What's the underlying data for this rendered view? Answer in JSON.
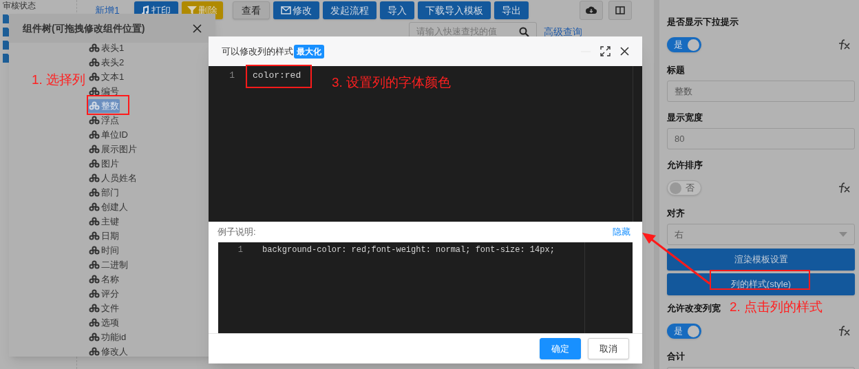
{
  "sidebar": {
    "heading": "审核状态"
  },
  "toolbar": {
    "buttons": [
      {
        "label": "新增1",
        "kind": "link"
      },
      {
        "label": "打印",
        "kind": "primary"
      },
      {
        "label": "删除",
        "kind": "warning"
      },
      {
        "label": "查看",
        "kind": "default"
      },
      {
        "label": "修改",
        "kind": "primary"
      },
      {
        "label": "发起流程",
        "kind": "primary"
      },
      {
        "label": "导入",
        "kind": "primary"
      },
      {
        "label": "下载导入模板",
        "kind": "primary"
      },
      {
        "label": "导出",
        "kind": "primary"
      }
    ]
  },
  "search": {
    "placeholder": "请输入快速查找的值",
    "advanced_link": "高级查询"
  },
  "properties": [
    {
      "kind": "toggle",
      "label": "是否显示下拉提示",
      "on": true,
      "text": "是"
    },
    {
      "kind": "input",
      "label": "标题",
      "value": "整数"
    },
    {
      "kind": "input",
      "label": "显示宽度",
      "value": "80"
    },
    {
      "kind": "toggle",
      "label": "允许排序",
      "on": false,
      "text": "否"
    },
    {
      "kind": "select",
      "label": "对齐",
      "value": "右"
    },
    {
      "kind": "button",
      "text": "渲染模板设置"
    },
    {
      "kind": "button",
      "text": "列的样式(style)"
    },
    {
      "kind": "toggle",
      "label": "允许改变列宽",
      "on": true,
      "text": "是"
    },
    {
      "kind": "input",
      "label": "合计"
    }
  ],
  "tree_dialog": {
    "title": "组件树(可拖拽修改组件位置)",
    "items": [
      {
        "label": "表头1",
        "selected": false
      },
      {
        "label": "表头2",
        "selected": false
      },
      {
        "label": "文本1",
        "selected": false
      },
      {
        "label": "编号",
        "selected": false
      },
      {
        "label": "整数",
        "selected": true
      },
      {
        "label": "浮点",
        "selected": false
      },
      {
        "label": "单位ID",
        "selected": false
      },
      {
        "label": "展示图片",
        "selected": false
      },
      {
        "label": "图片",
        "selected": false
      },
      {
        "label": "人员姓名",
        "selected": false
      },
      {
        "label": "部门",
        "selected": false
      },
      {
        "label": "创建人",
        "selected": false
      },
      {
        "label": "主键",
        "selected": false
      },
      {
        "label": "日期",
        "selected": false
      },
      {
        "label": "时间",
        "selected": false
      },
      {
        "label": "二进制",
        "selected": false
      },
      {
        "label": "名称",
        "selected": false
      },
      {
        "label": "评分",
        "selected": false
      },
      {
        "label": "文件",
        "selected": false
      },
      {
        "label": "选项",
        "selected": false
      },
      {
        "label": "功能id",
        "selected": false
      },
      {
        "label": "修改人",
        "selected": false
      }
    ]
  },
  "style_dialog": {
    "title": "可以修改列的样式",
    "badge": "最大化",
    "code": [
      {
        "line": "1",
        "text": "color:red"
      }
    ],
    "example_label": "例子说明:",
    "hide_link": "隐藏",
    "example": [
      {
        "line": "1",
        "text": "background-color: red;font-weight: normal; font-size: 14px;"
      }
    ],
    "buttons": [
      {
        "label": "确定",
        "kind": "primary"
      },
      {
        "label": "取消",
        "kind": "default"
      }
    ]
  },
  "annotations": [
    "1. 选择列",
    "3. 设置列的字体颜色",
    "2. 点击列的样式"
  ]
}
